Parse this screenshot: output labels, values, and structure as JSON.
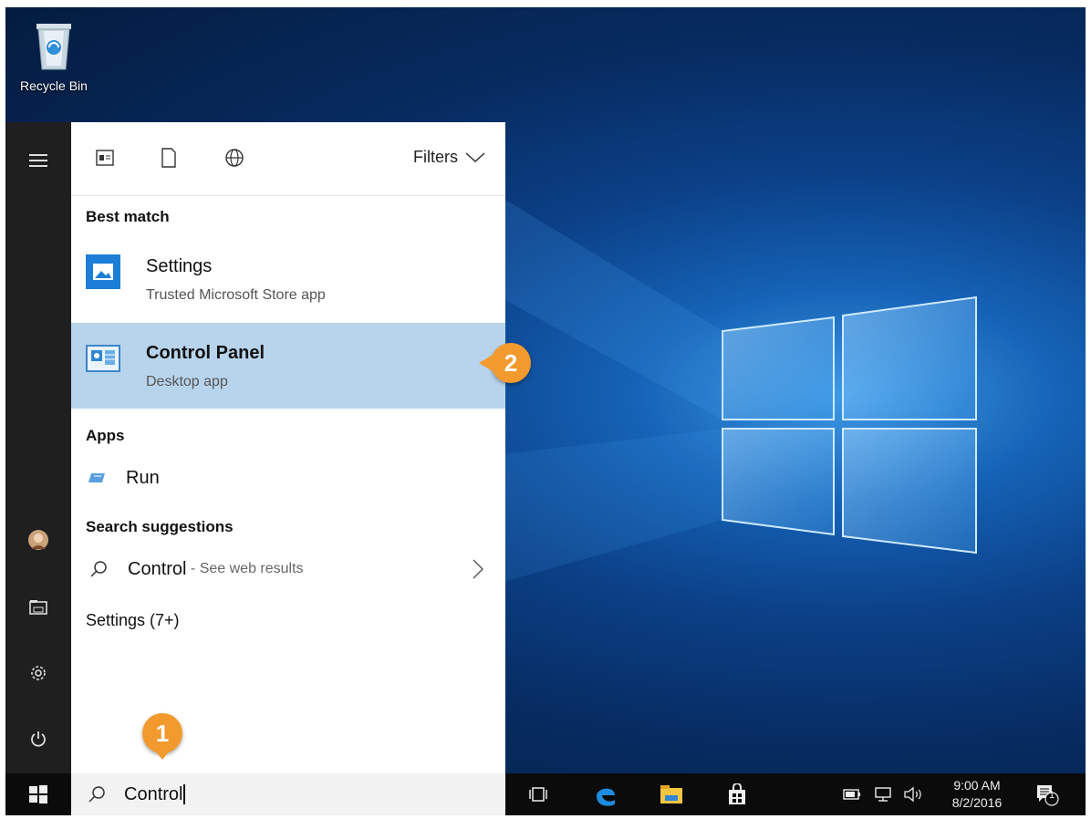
{
  "desktop": {
    "recycle_bin_label": "Recycle Bin"
  },
  "rail": {
    "icons": [
      "hamburger-menu-icon",
      "user-avatar",
      "file-explorer-icon",
      "settings-gear-icon",
      "power-icon"
    ]
  },
  "filter_bar": {
    "icons": [
      "apps-filter-icon",
      "documents-filter-icon",
      "web-filter-icon"
    ],
    "filters_label": "Filters"
  },
  "best_match": {
    "heading": "Best match",
    "items": [
      {
        "title": "Settings",
        "subtitle": "Trusted Microsoft Store app",
        "icon": "settings-app-icon",
        "selected": false
      },
      {
        "title": "Control Panel",
        "subtitle": "Desktop app",
        "icon": "control-panel-icon",
        "selected": true
      }
    ]
  },
  "apps": {
    "heading": "Apps",
    "items": [
      {
        "label": "Run",
        "icon": "run-icon"
      }
    ]
  },
  "search_suggestions": {
    "heading": "Search suggestions",
    "items": [
      {
        "term": "Control",
        "suffix": " - See web results"
      }
    ]
  },
  "settings_group": {
    "heading": "Settings (7+)"
  },
  "search": {
    "value": "Control",
    "icon": "search-icon"
  },
  "taskbar": {
    "icons": [
      "windows-start-icon",
      "task-view-icon",
      "edge-browser-icon",
      "file-explorer-icon",
      "store-icon"
    ],
    "tray_icons": [
      "battery-icon",
      "network-icon",
      "volume-icon"
    ],
    "time": "9:00 AM",
    "date": "8/2/2016",
    "notification_count": "1"
  },
  "callouts": [
    "1",
    "2"
  ],
  "colors": {
    "selection": "#b8d4ec",
    "callout": "#f29a2e",
    "taskbar": "#0b0b0b",
    "rail": "#1f1f1f"
  }
}
